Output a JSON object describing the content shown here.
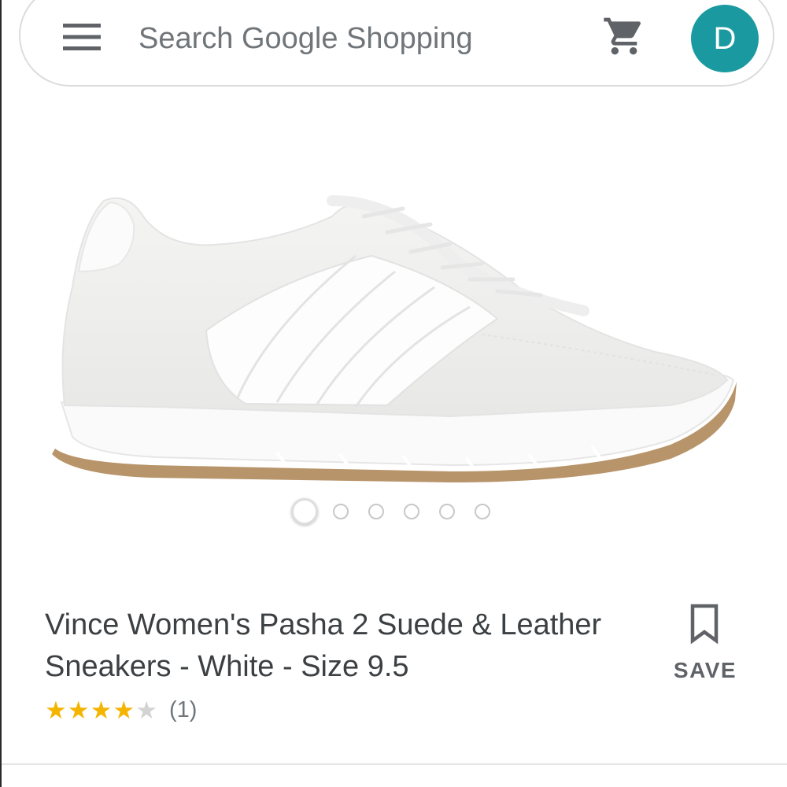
{
  "search": {
    "placeholder": "Search Google Shopping"
  },
  "header": {
    "menu_icon": "hamburger-menu-icon",
    "cart_icon": "shopping-cart-icon",
    "avatar_initial": "D",
    "avatar_color": "#1a9aa0"
  },
  "gallery": {
    "image_count": 6,
    "active_index": 0
  },
  "product": {
    "title": "Vince Women's Pasha 2 Suede & Leather Sneakers - White - Size 9.5",
    "rating": 4,
    "rating_max": 5,
    "review_count": "(1)",
    "star_color": "#f4b400"
  },
  "actions": {
    "save_label": "SAVE",
    "save_icon": "bookmark-icon"
  }
}
